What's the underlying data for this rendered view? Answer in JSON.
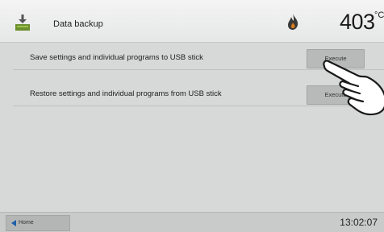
{
  "header": {
    "title": "Data backup",
    "app_icon": "download-tray-icon",
    "status_icon": "flame-icon",
    "temperature": "403",
    "temperature_unit": "°C"
  },
  "rows": [
    {
      "label": "Save settings and individual programs to USB stick",
      "button": "Execute"
    },
    {
      "label": "Restore settings and individual programs from USB stick",
      "button": "Execute"
    }
  ],
  "footer": {
    "home_label": "Home",
    "home_icon": "back-arrow-icon",
    "time": "13:02:07"
  },
  "colors": {
    "background": "#d7d9d9",
    "header": "#eeeeee",
    "button": "#b8baba",
    "accent": "#1c5fa8"
  }
}
